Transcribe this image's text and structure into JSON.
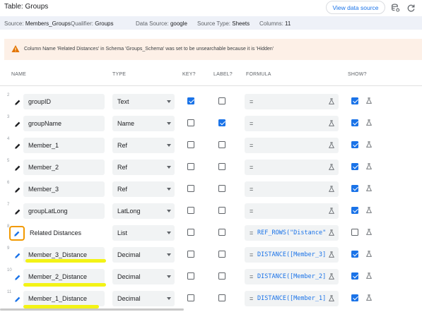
{
  "header": {
    "title": "Table: Groups",
    "view_button": "View data source"
  },
  "info": {
    "source_label": "Source:",
    "source_value": "Members_Groups",
    "qualifier_label": "Qualifier:",
    "qualifier_value": "Groups",
    "datasource_label": "Data Source:",
    "datasource_value": "google",
    "sourcetype_label": "Source Type:",
    "sourcetype_value": "Sheets",
    "columns_label": "Columns:",
    "columns_value": "11"
  },
  "warning": {
    "message": "Column Name 'Related Distances' in Schema 'Groups_Schema' was set to be unsearchable because it is 'Hidden'"
  },
  "columns": {
    "name": "NAME",
    "type": "TYPE",
    "key": "KEY?",
    "label": "LABEL?",
    "formula": "FORMULA",
    "show": "SHOW?"
  },
  "rows": [
    {
      "num": "2",
      "name": "groupID",
      "type": "Text",
      "key": true,
      "label": false,
      "formula_eq": "=",
      "formula": "",
      "show": true
    },
    {
      "num": "3",
      "name": "groupName",
      "type": "Name",
      "key": false,
      "label": true,
      "formula_eq": "=",
      "formula": "",
      "show": true
    },
    {
      "num": "4",
      "name": "Member_1",
      "type": "Ref",
      "key": false,
      "label": false,
      "formula_eq": "=",
      "formula": "",
      "show": true
    },
    {
      "num": "5",
      "name": "Member_2",
      "type": "Ref",
      "key": false,
      "label": false,
      "formula_eq": "=",
      "formula": "",
      "show": true
    },
    {
      "num": "6",
      "name": "Member_3",
      "type": "Ref",
      "key": false,
      "label": false,
      "formula_eq": "=",
      "formula": "",
      "show": true
    },
    {
      "num": "7",
      "name": "groupLatLong",
      "type": "LatLong",
      "key": false,
      "label": false,
      "formula_eq": "=",
      "formula": "",
      "show": true
    },
    {
      "num": "8",
      "name": "Related Distances",
      "type": "List",
      "key": false,
      "label": false,
      "formula_eq": "=",
      "formula": "REF_ROWS(\"Distance\"",
      "show": false
    },
    {
      "num": "9",
      "name": "Member_3_Distance",
      "type": "Decimal",
      "key": false,
      "label": false,
      "formula_eq": "=",
      "formula": "DISTANCE([Member_3]",
      "show": true
    },
    {
      "num": "10",
      "name": "Member_2_Distance",
      "type": "Decimal",
      "key": false,
      "label": false,
      "formula_eq": "=",
      "formula": "DISTANCE([Member_2]",
      "show": true
    },
    {
      "num": "11",
      "name": "Member_1_Distance",
      "type": "Decimal",
      "key": false,
      "label": false,
      "formula_eq": "=",
      "formula": "DISTANCE([Member_1]",
      "show": true
    }
  ],
  "colors": {
    "accent": "#1a73e8",
    "warning_bg": "#fdf0e7",
    "focus_ring": "#f29900",
    "highlight": "#f2f20a"
  },
  "icons": {
    "edit": "pencil-icon",
    "test": "beaker-icon",
    "warning": "warning-icon",
    "data": "database-settings-icon",
    "refresh": "refresh-icon"
  }
}
